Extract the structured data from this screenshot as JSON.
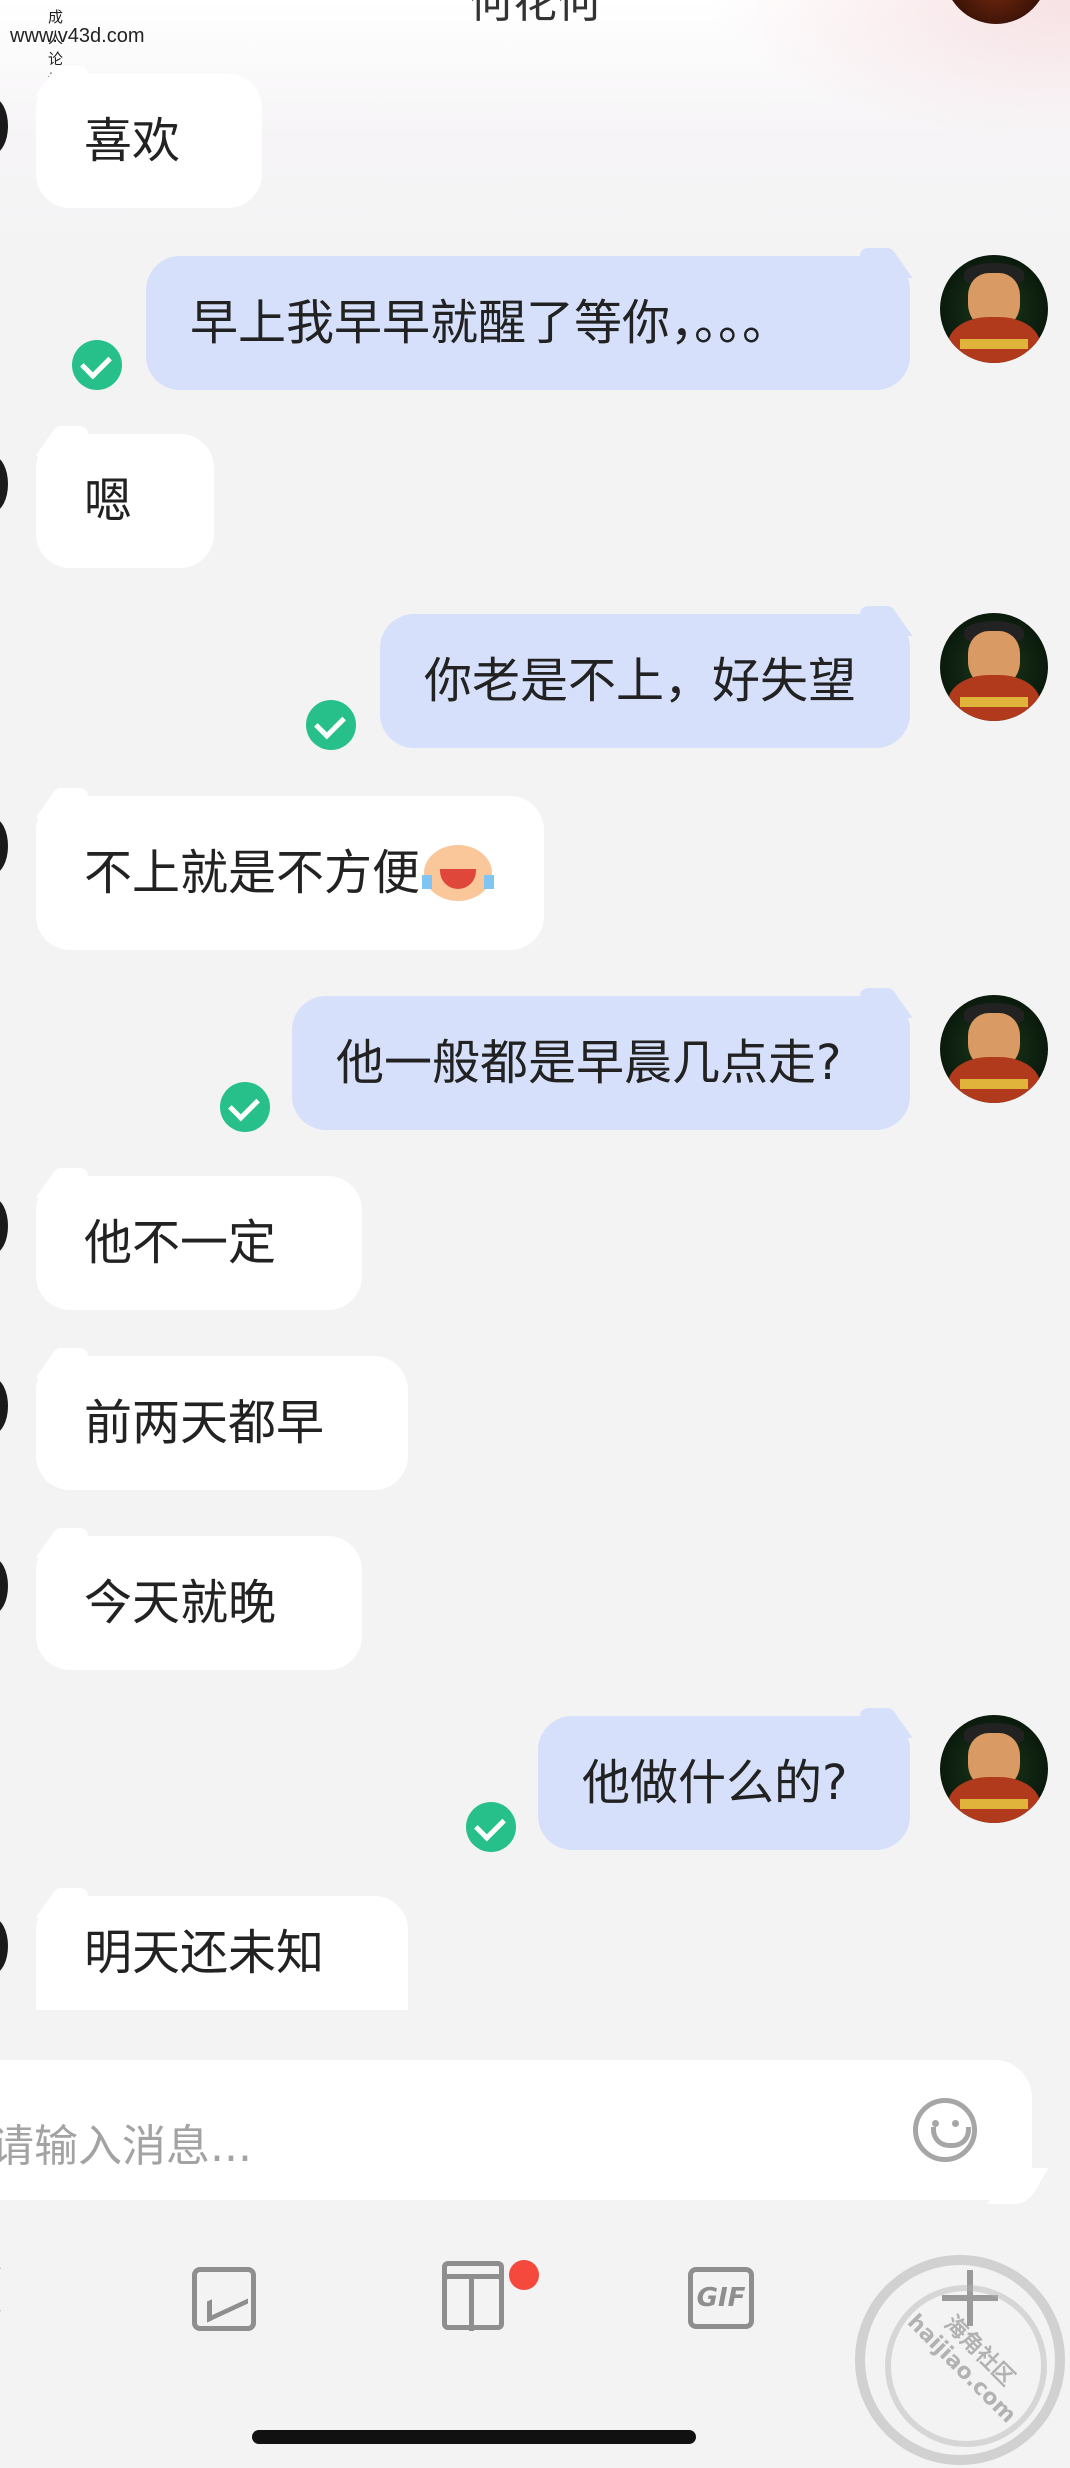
{
  "header": {
    "title": "何花何"
  },
  "watermark": {
    "small": "成人论坛",
    "site": "www.v43d.com"
  },
  "messages": [
    {
      "side": "in",
      "text": "喜欢"
    },
    {
      "side": "out",
      "text": "早上我早早就醒了等你，。。。",
      "read": true
    },
    {
      "side": "in",
      "text": "嗯"
    },
    {
      "side": "out",
      "text": "你老是不上，好失望",
      "read": true
    },
    {
      "side": "in",
      "text": "不上就是不方便",
      "emoji": "laugh-cry-emoji"
    },
    {
      "side": "out",
      "text": "他一般都是早晨几点走?",
      "read": true
    },
    {
      "side": "in",
      "text": "他不一定"
    },
    {
      "side": "in",
      "text": "前两天都早"
    },
    {
      "side": "in",
      "text": "今天就晚"
    },
    {
      "side": "out",
      "text": "他做什么的?",
      "read": true
    },
    {
      "side": "in",
      "text": "明天还未知"
    }
  ],
  "input": {
    "placeholder": "请输入消息..."
  },
  "toolbar": {
    "items": [
      "chevron-left-icon",
      "image-icon",
      "gift-icon",
      "gif-icon",
      "plus-icon"
    ],
    "gif_label": "GIF",
    "gift_badge": true
  },
  "stamp": {
    "line1": "海角社区",
    "line2": "haijiao.com"
  },
  "colors": {
    "outgoing_bubble": "#d6e0fb",
    "incoming_bubble": "#ffffff",
    "read_check": "#27c08a",
    "badge": "#f4493c"
  }
}
